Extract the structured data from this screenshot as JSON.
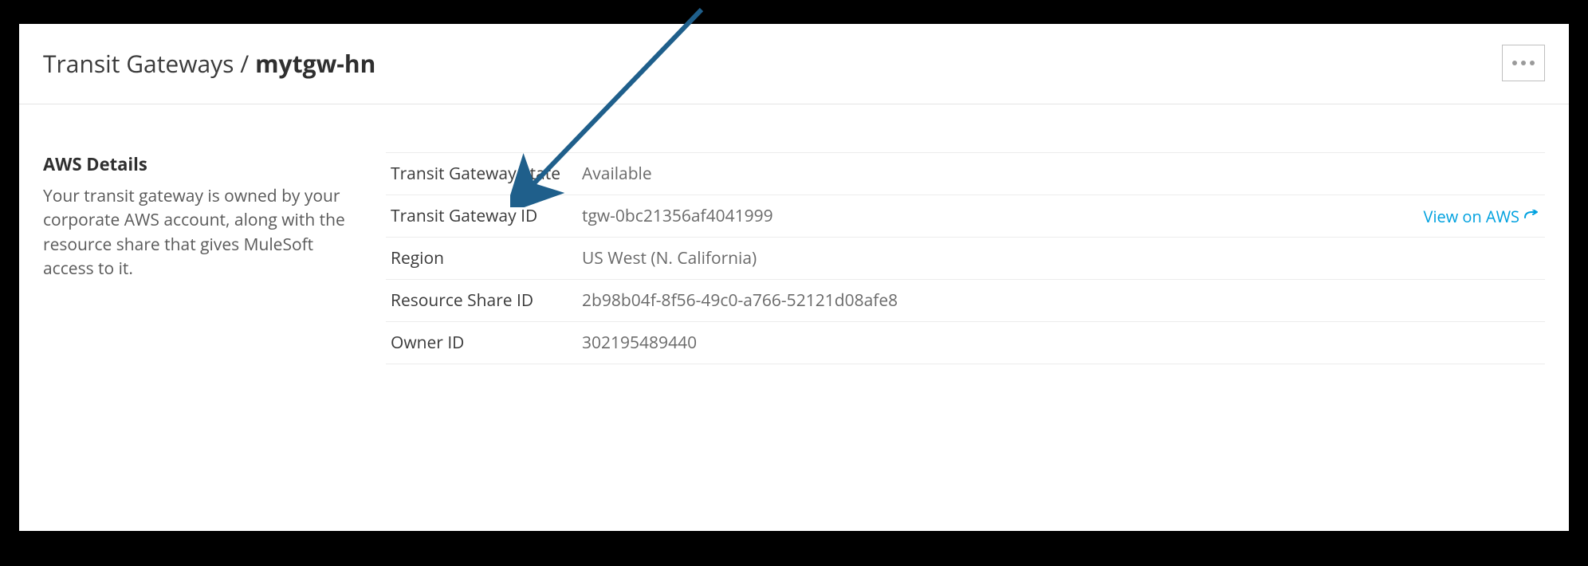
{
  "breadcrumb": {
    "parent": "Transit Gateways",
    "separator": "/",
    "current": "mytgw-hn"
  },
  "aws_details": {
    "title": "AWS Details",
    "description": "Your transit gateway is owned by your corporate AWS account, along with the resource share that gives MuleSoft access to it.",
    "rows": [
      {
        "label": "Transit Gateway State",
        "value": "Available"
      },
      {
        "label": "Transit Gateway ID",
        "value": "tgw-0bc21356af4041999",
        "action": "View on AWS"
      },
      {
        "label": "Region",
        "value": "US West (N. California)"
      },
      {
        "label": "Resource Share ID",
        "value": "2b98b04f-8f56-49c0-a766-52121d08afe8"
      },
      {
        "label": "Owner ID",
        "value": "302195489440"
      }
    ]
  },
  "colors": {
    "link": "#00a1df",
    "arrow": "#1f5f8b"
  }
}
